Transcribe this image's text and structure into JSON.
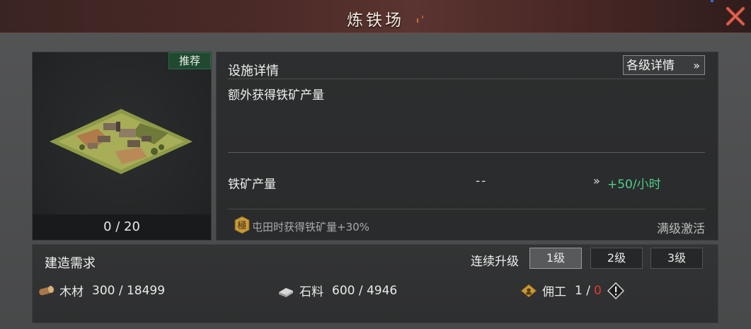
{
  "window": {
    "title": "炼铁场"
  },
  "facility": {
    "badge": "推荐",
    "count": "0 / 20",
    "building_icon": "ironworks-building"
  },
  "details": {
    "section_title": "设施详情",
    "levels_button": "各级详情",
    "levels_button_icon": "double-chevron-right",
    "description": "额外获得铁矿产量",
    "stat_label": "铁矿产量",
    "stat_current": "--",
    "stat_arrow": "»",
    "stat_next": "+50/小时",
    "bonus_icon_char": "極",
    "bonus_text": "屯田时获得铁矿量+30%",
    "max_level_text": "满级激活"
  },
  "build": {
    "section_title": "建造需求",
    "continuous_label": "连续升级",
    "levels": [
      {
        "label": "1级",
        "selected": true
      },
      {
        "label": "2级",
        "selected": false
      },
      {
        "label": "3级",
        "selected": false
      }
    ],
    "resources": {
      "wood": {
        "label": "木材",
        "value": "300 / 18499",
        "icon": "wood-log"
      },
      "stone": {
        "label": "石料",
        "value": "600 / 4946",
        "icon": "stone-block"
      },
      "worker": {
        "label": "佣工",
        "current": "1 /",
        "required": "0",
        "icon": "worker-emblem"
      }
    }
  },
  "colors": {
    "accent_green": "#4fcf8a",
    "warning_red": "#e03a2f",
    "badge_green": "#1f4a30"
  }
}
